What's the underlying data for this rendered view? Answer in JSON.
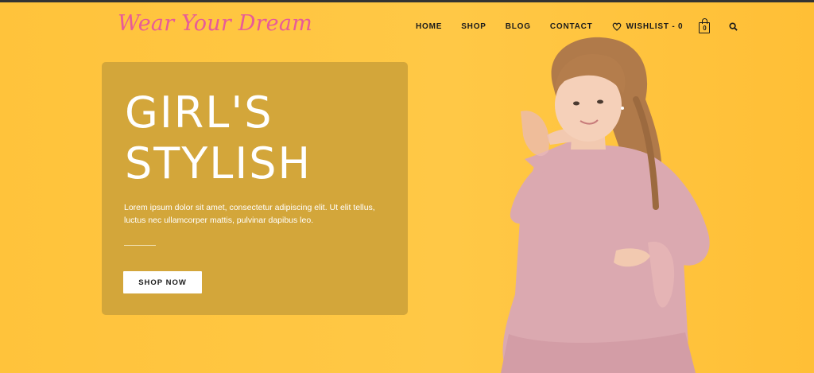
{
  "header": {
    "logo": "Wear Your Dream",
    "nav": [
      {
        "label": "HOME"
      },
      {
        "label": "SHOP"
      },
      {
        "label": "BLOG"
      },
      {
        "label": "CONTACT"
      }
    ],
    "wishlist_label": "WISHLIST - 0",
    "cart_count": "0",
    "icons": [
      "heart-icon",
      "shopping-bag-icon",
      "search-icon"
    ]
  },
  "hero": {
    "title_line1": "GIRL'S",
    "title_line2": "STYLISH",
    "description": "Lorem ipsum dolor sit amet, consectetur adipiscing elit. Ut elit tellus, luctus nec ullamcorper mattis, pulvinar dapibus leo.",
    "button_label": "SHOP NOW"
  },
  "colors": {
    "background": "#ffc53d",
    "panel": "#d3a63a",
    "logo": "#e85b98",
    "dress": "#dba9b0"
  }
}
